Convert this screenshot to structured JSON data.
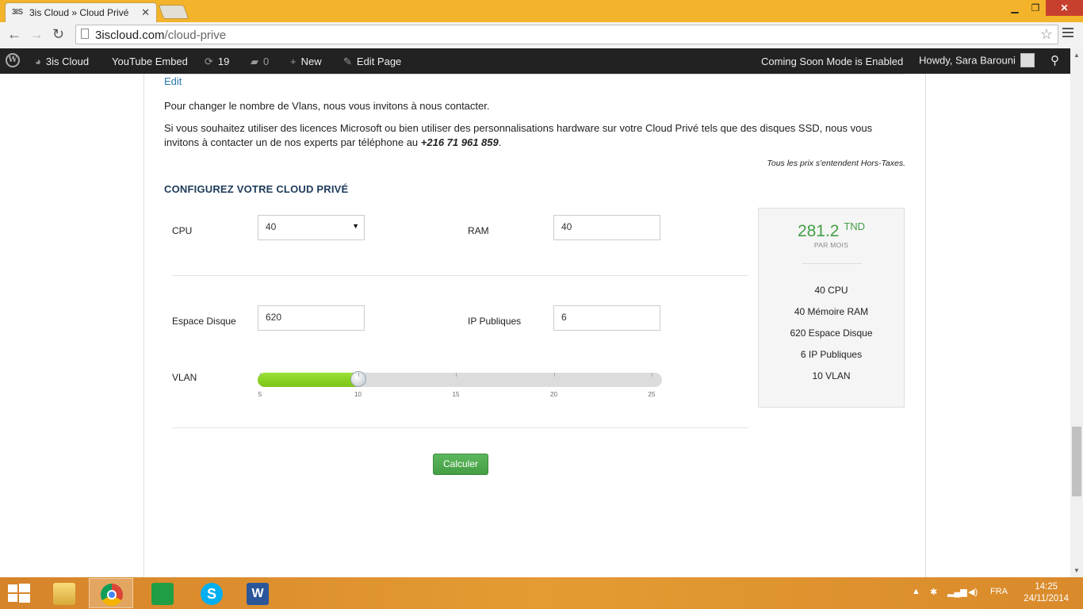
{
  "browser": {
    "tab_title": "3is Cloud » Cloud Privé",
    "tab_favicon": "3IS",
    "url_host": "3iscloud.com",
    "url_path": "/cloud-prive"
  },
  "adminbar": {
    "site_name": "3is Cloud",
    "youtube": "YouTube Embed",
    "updates_count": "19",
    "comments_count": "0",
    "new_label": "New",
    "edit_page": "Edit Page",
    "coming_soon": "Coming Soon Mode is Enabled",
    "howdy": "Howdy, Sara Barouni"
  },
  "page": {
    "edit_link": "Edit",
    "para1": "Pour changer le nombre de Vlans, nous vous invitons à nous contacter.",
    "para2_prefix": "Si vous souhaitez utiliser des licences Microsoft ou bien utiliser des personnalisations hardware sur votre Cloud Privé tels que des disques SSD, nous vous invitons à contacter un de nos experts par téléphone au ",
    "phone": "+216 71 961 859",
    "para2_suffix": ".",
    "tax_note": "Tous les prix s'entendent Hors-Taxes.",
    "config_title": "CONFIGUREZ VOTRE CLOUD PRIVÉ"
  },
  "form": {
    "cpu_label": "CPU",
    "cpu_value": "40",
    "ram_label": "RAM",
    "ram_value": "40",
    "disk_label": "Espace Disque",
    "disk_value": "620",
    "ip_label": "IP Publiques",
    "ip_value": "6",
    "vlan_label": "VLAN",
    "vlan_value": 10,
    "vlan_min": 5,
    "vlan_max": 25,
    "vlan_ticks": [
      "5",
      "10",
      "15",
      "20",
      "25"
    ],
    "calc_button": "Calculer"
  },
  "summary": {
    "price": "281.2",
    "currency": "TND",
    "period": "PAR MOIS",
    "items": [
      "40 CPU",
      "40 Mémoire RAM",
      "620 Espace Disque",
      "6 IP Publiques",
      "10 VLAN"
    ]
  },
  "taskbar": {
    "lang": "FRA",
    "time": "14:25",
    "date": "24/11/2014",
    "apps": [
      "file-explorer",
      "chrome",
      "store",
      "skype",
      "word"
    ]
  },
  "colors": {
    "accent_green": "#43a047",
    "title_blue": "#1d3b5a",
    "taskbar": "#e59b33",
    "chrome_frame": "#f3b32a"
  }
}
